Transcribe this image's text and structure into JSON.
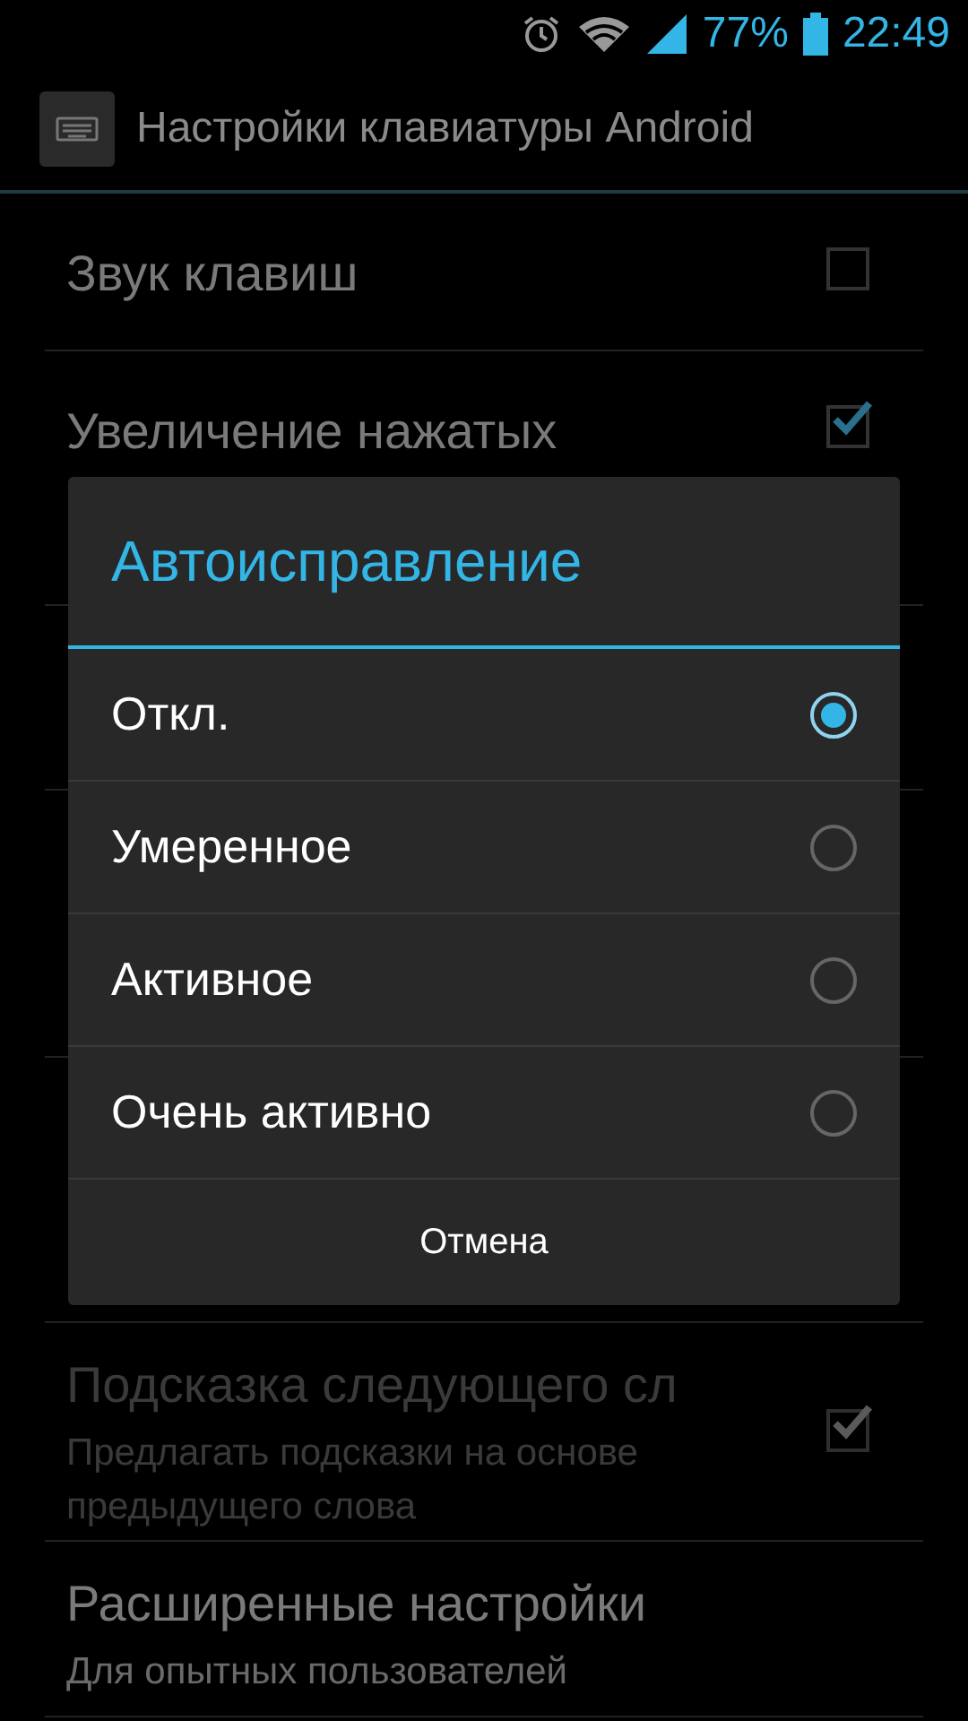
{
  "status_bar": {
    "battery": "77%",
    "time": "22:49"
  },
  "action_bar": {
    "title": "Настройки клавиатуры Android"
  },
  "settings": [
    {
      "kind": "check",
      "title": "Звук клавиш",
      "checked": false,
      "disabled": false
    },
    {
      "kind": "check",
      "title": "Увеличение нажатых",
      "checked": true,
      "disabled": false
    },
    {
      "kind": "hidden"
    },
    {
      "kind": "hidden"
    },
    {
      "kind": "hidden"
    },
    {
      "kind": "check",
      "title": "Подсказка следующего сл",
      "summary": "Предлагать подсказки на основе предыдущего слова",
      "checked": true,
      "disabled": true
    },
    {
      "kind": "link",
      "title": "Расширенные настройки",
      "summary": "Для опытных пользователей",
      "disabled": false
    }
  ],
  "dialog": {
    "title": "Автоисправление",
    "options": [
      {
        "label": "Откл.",
        "selected": true
      },
      {
        "label": "Умеренное",
        "selected": false
      },
      {
        "label": "Активное",
        "selected": false
      },
      {
        "label": "Очень активно",
        "selected": false
      }
    ],
    "cancel": "Отмена"
  }
}
